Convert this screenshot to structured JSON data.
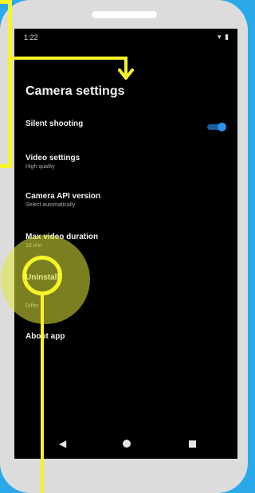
{
  "status_bar": {
    "time": "1:22",
    "icons": "▾ ▮"
  },
  "page": {
    "title": "Camera settings"
  },
  "settings": [
    {
      "label": "Silent shooting",
      "sub": ""
    },
    {
      "label": "Video settings",
      "sub": "High quality"
    },
    {
      "label": "Camera API version",
      "sub": "Select automatically"
    },
    {
      "label": "Max video duration",
      "sub": "10 min"
    },
    {
      "label": "Uninstall",
      "sub": "Differ"
    },
    {
      "label": "About app",
      "sub": ""
    }
  ],
  "silent_shooting_enabled": true,
  "colors": {
    "annotation": "#f6f52a",
    "accent": "#2e8fe8",
    "background": "#29a9ea"
  },
  "icons": {
    "back": "arrow-left",
    "nav_back": "triangle-left",
    "nav_home": "circle",
    "nav_recents": "square"
  }
}
